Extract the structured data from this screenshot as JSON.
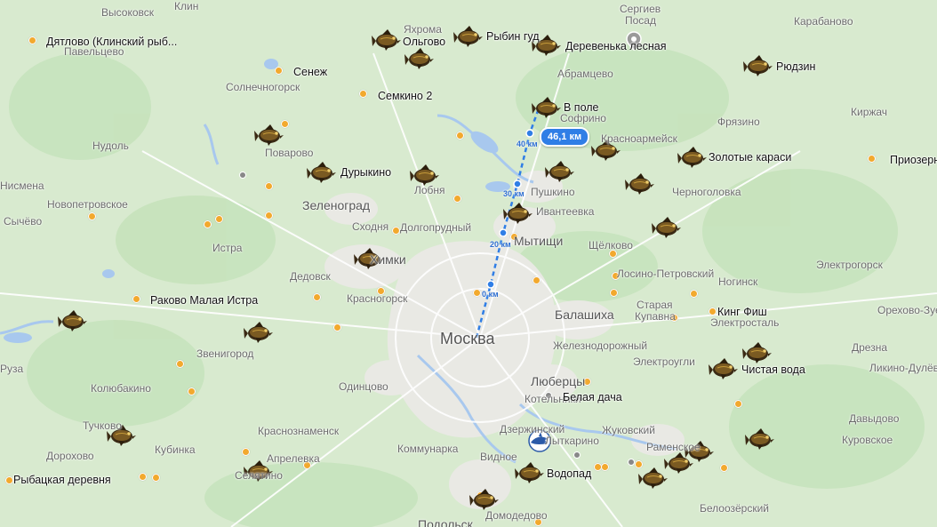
{
  "map": {
    "capital": "Москва",
    "distance_badge": "46,1 км",
    "route_ticks": [
      "0 км",
      "20 км",
      "30 км",
      "40 км"
    ],
    "fishing_spots": [
      "Дятлово  (Клинский рыб...",
      "Ольгово",
      "Рыбин гуд",
      "Деревенька лесная",
      "Рюдзин",
      "Сенеж",
      "Семкино 2",
      "В поле",
      "Золотые караси",
      "Приозерн",
      "Дурыкино",
      "Раково Малая Истра",
      "Кинг Фиш",
      "Чистая вода",
      "Белая дача",
      "Водопад",
      "Рыбацкая деревня"
    ],
    "cities": [
      "Зеленоград",
      "Химки",
      "Балашиха",
      "Люберцы"
    ],
    "towns": [
      "Высоковск",
      "Клин",
      "Яхрома",
      "Сергиев",
      "Посад",
      "Карабаново",
      "Павельцево",
      "Солнечногорск",
      "Абрамцево",
      "Софрино",
      "Фрязино",
      "Киржач",
      "Нудоль",
      "Поварово",
      "Красноармейск",
      "Лобня",
      "Пушкино",
      "Черноголовка",
      "Нисмена",
      "Новопетровское",
      "Сычёво",
      "Истра",
      "Сходня",
      "Долгопрудный",
      "Ивантеевка",
      "Щёлково",
      "Дедовск",
      "Мытищи",
      "Лосино-Петровский",
      "Ногинск",
      "Электрогорск",
      "Красногорск",
      "Старая",
      "Купавна",
      "Электросталь",
      "Орехово-Зуе",
      "Железнодорожный",
      "Дрезна",
      "Звенигород",
      "Руза",
      "Электроугли",
      "Ликино-Дулёв",
      "Колюбакино",
      "Одинцово",
      "Котельники",
      "Давыдово",
      "Тучково",
      "Краснознаменск",
      "Жуковский",
      "Раменское",
      "Куровское",
      "Дорохово",
      "Кубинка",
      "Апрелевка",
      "Коммунарка",
      "Видное",
      "Дзержинский",
      "Лыткарино",
      "Селятино",
      "Домодедово",
      "Белоозёрский",
      "Подольск"
    ]
  }
}
